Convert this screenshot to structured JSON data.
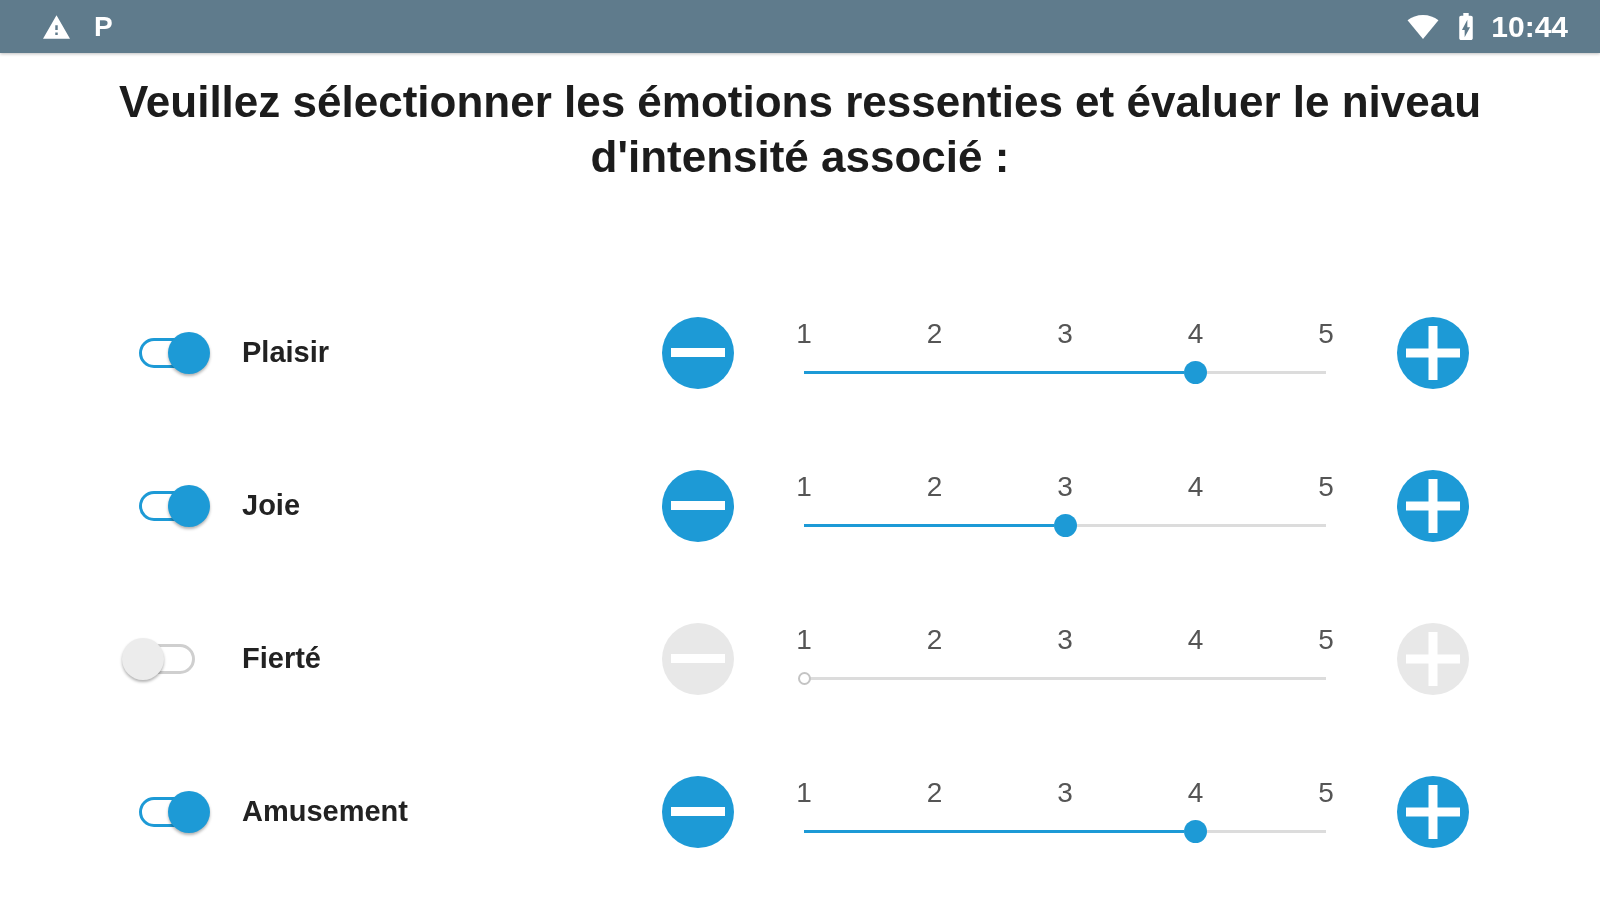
{
  "status_bar": {
    "notification_glyph": "P",
    "time": "10:44"
  },
  "title": "Veuillez sélectionner les émotions ressenties et évaluer le niveau d'intensité associé :",
  "emotions": [
    {
      "label": "Plaisir",
      "on": true,
      "scale": [
        "1",
        "2",
        "3",
        "4",
        "5"
      ],
      "level": 0.75
    },
    {
      "label": "Joie",
      "on": true,
      "scale": [
        "1",
        "2",
        "3",
        "4",
        "5"
      ],
      "level": 0.5
    },
    {
      "label": "Fierté",
      "on": false,
      "scale": [
        "1",
        "2",
        "3",
        "4",
        "5"
      ],
      "level": 0
    },
    {
      "label": "Amusement",
      "on": true,
      "scale": [
        "1",
        "2",
        "3",
        "4",
        "5"
      ],
      "level": 0.75
    }
  ]
}
